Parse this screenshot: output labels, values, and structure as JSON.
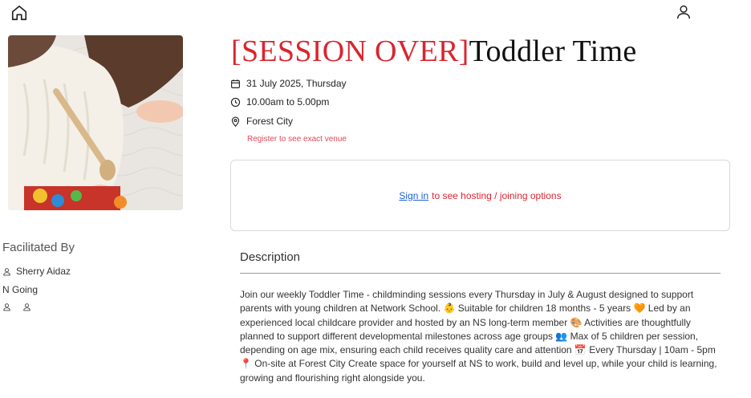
{
  "nav": {
    "home_icon": "home-icon",
    "profile_icon": "user-icon"
  },
  "event": {
    "title_status": "[SESSION OVER]",
    "title_name": "Toddler Time",
    "date": "31 July 2025, Thursday",
    "time": "10.00am to 5.00pm",
    "location": "Forest City",
    "venue_note": "Register to see exact venue"
  },
  "signin": {
    "link": "Sign in",
    "text": "to see hosting / joining options"
  },
  "facilitators": {
    "heading": "Facilitated By",
    "host": "Sherry Aidaz",
    "going": "N Going"
  },
  "description": {
    "heading": "Description",
    "body": "Join our weekly Toddler Time - childminding sessions every Thursday in July & August designed to support parents with young children at Network School. 👶 Suitable for children 18 months - 5 years 🧡 Led by an experienced local childcare provider and hosted by an NS long-term member 🎨 Activities are thoughtfully planned to support different developmental milestones across age groups 👥 Max of 5 children per session, depending on age mix, ensuring each child receives quality care and attention 📅 Every Thursday | 10am - 5pm 📍 On-site at Forest City Create space for yourself at NS to work, build and level up, while your child is learning, growing and flourishing right alongside you."
  },
  "colors": {
    "status_red": "#d8262f",
    "link_blue": "#1a62d8",
    "venue_pink": "#e0485a"
  }
}
